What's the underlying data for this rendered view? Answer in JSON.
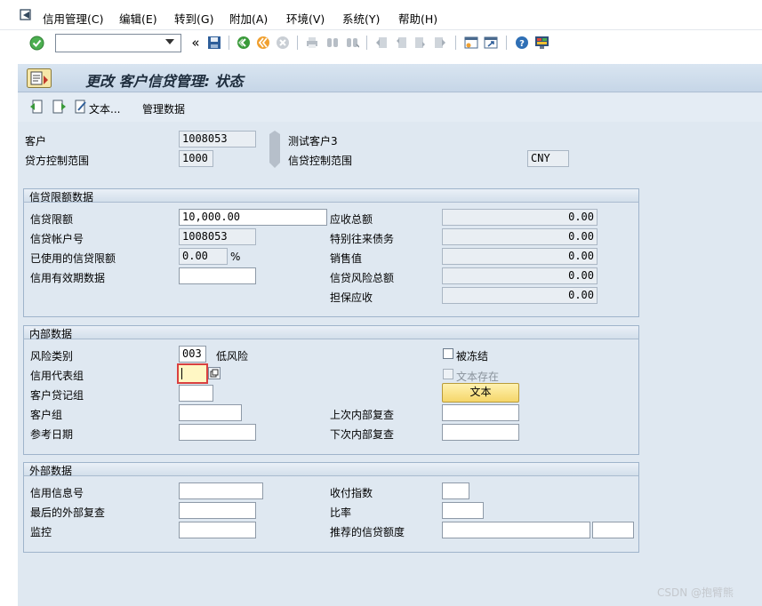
{
  "menu": {
    "items": [
      "信用管理(C)",
      "编辑(E)",
      "转到(G)",
      "附加(A)",
      "环境(V)",
      "系统(Y)",
      "帮助(H)"
    ]
  },
  "toolbar": {
    "command_value": "",
    "icons": [
      "enter-icon",
      "save-icon",
      "back-icon",
      "exit-icon",
      "cancel-icon",
      "print-icon",
      "find-icon",
      "find-next-icon",
      "first-page-icon",
      "prev-page-icon",
      "next-page-icon",
      "last-page-icon",
      "create-session-icon",
      "shortcut-icon",
      "help-icon",
      "layout-icon"
    ]
  },
  "title": "更改 客户信贷管理: 状态",
  "appbar": {
    "text_button": "文本...",
    "admin_button": "管理数据"
  },
  "header": {
    "customer_label": "客户",
    "customer_value": "1008053",
    "customer_name": "测试客户3",
    "cca_label": "贷方控制范围",
    "cca_value": "1000",
    "cca_name": "信贷控制范围",
    "currency": "CNY"
  },
  "credit_limit": {
    "title": "信贷限额数据",
    "limit_label": "信贷限额",
    "limit_value": "10,000.00",
    "account_label": "信贷帐户号",
    "account_value": "1008053",
    "used_label": "已使用的信贷限额",
    "used_value": "0.00",
    "used_unit": "%",
    "valid_label": "信用有效期数据",
    "valid_value": "",
    "receivables_label": "应收总额",
    "receivables_value": "0.00",
    "special_label": "特别往来债务",
    "special_value": "0.00",
    "sales_label": "销售值",
    "sales_value": "0.00",
    "exposure_label": "信贷风险总额",
    "exposure_value": "0.00",
    "secured_label": "担保应收",
    "secured_value": "0.00"
  },
  "internal": {
    "title": "内部数据",
    "risk_label": "风险类别",
    "risk_value": "003",
    "risk_text": "低风险",
    "rep_label": "信用代表组",
    "rep_value": "",
    "cust_credit_label": "客户贷记组",
    "cust_credit_value": "",
    "cust_group_label": "客户组",
    "cust_group_value": "",
    "ref_date_label": "参考日期",
    "ref_date_value": "",
    "blocked_label": "被冻结",
    "text_exists_label": "文本存在",
    "text_button": "文本",
    "last_review_label": "上次内部复查",
    "last_review_value": "",
    "next_review_label": "下次内部复查",
    "next_review_value": ""
  },
  "external": {
    "title": "外部数据",
    "credit_info_label": "信用信息号",
    "credit_info_value": "",
    "last_ext_label": "最后的外部复查",
    "last_ext_value": "",
    "monitor_label": "监控",
    "monitor_value": "",
    "payment_label": "收付指数",
    "payment_value": "",
    "rating_label": "比率",
    "rating_value": "",
    "recommended_label": "推荐的信贷额度",
    "recommended_value": "",
    "recommended_currency": ""
  },
  "watermark": "CSDN @抱臂熊"
}
